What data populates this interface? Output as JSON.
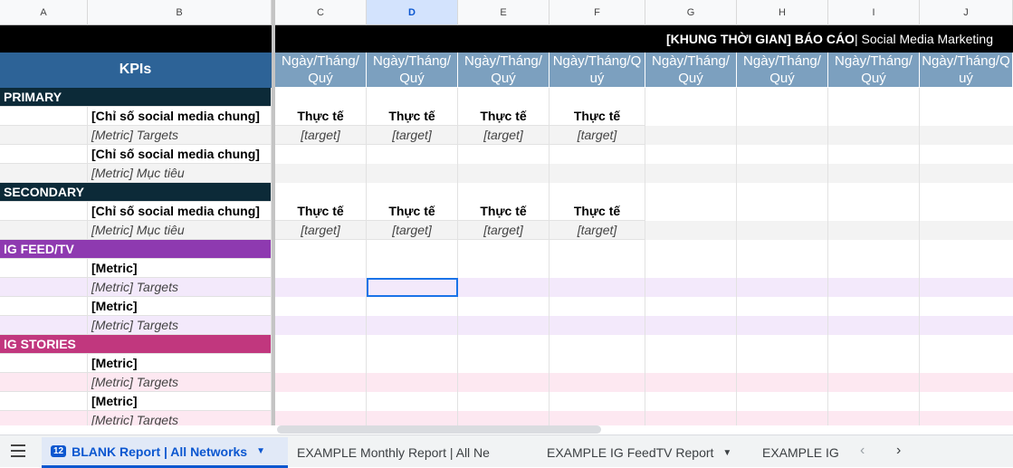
{
  "columns": [
    "A",
    "B",
    "C",
    "D",
    "E",
    "F",
    "G",
    "H",
    "I",
    "J"
  ],
  "selected_column": "D",
  "title_prefix": "[KHUNG THỜI GIAN] BÁO CÁO",
  "title_suffix": "| Social Media Marketing",
  "kpis_label": "KPIs",
  "period_headers": [
    "Ngày/Tháng/Quý",
    "Ngày/Tháng/Quý",
    "Ngày/Tháng/Quý",
    "Ngày/Tháng/Quý",
    "Ngày/Tháng/Quý",
    "Ngày/Tháng/Quý",
    "Ngày/Tháng/Quý",
    "Ngày/Tháng/Quý"
  ],
  "sections": {
    "primary": "PRIMARY",
    "secondary": "SECONDARY",
    "ig_feed": "IG FEED/TV",
    "ig_stories": "IG STORIES"
  },
  "rows": {
    "general_metric": "[Chỉ số social media chung]",
    "metric_targets": "[Metric] Targets",
    "metric_muc_tieu": "[Metric] Mục tiêu",
    "metric": "[Metric]",
    "actual": "Thực tế",
    "target": "[target]"
  },
  "section_colors": {
    "primary": "#0c2a38",
    "ig_feed": "#8e3ab0",
    "ig_stories": "#c1377e",
    "header_blue": "#2d6397",
    "period_blue": "#7ca0bf",
    "row_gray": "#f3f3f3",
    "row_purple": "#f3e9fb",
    "row_pink": "#fde8f1"
  },
  "tabs": {
    "active": "BLANK Report | All Networks",
    "active_badge": "12",
    "tab2": "EXAMPLE Monthly Report | All Ne",
    "tab3": "EXAMPLE IG FeedTV Report",
    "tab4": "EXAMPLE IG"
  }
}
